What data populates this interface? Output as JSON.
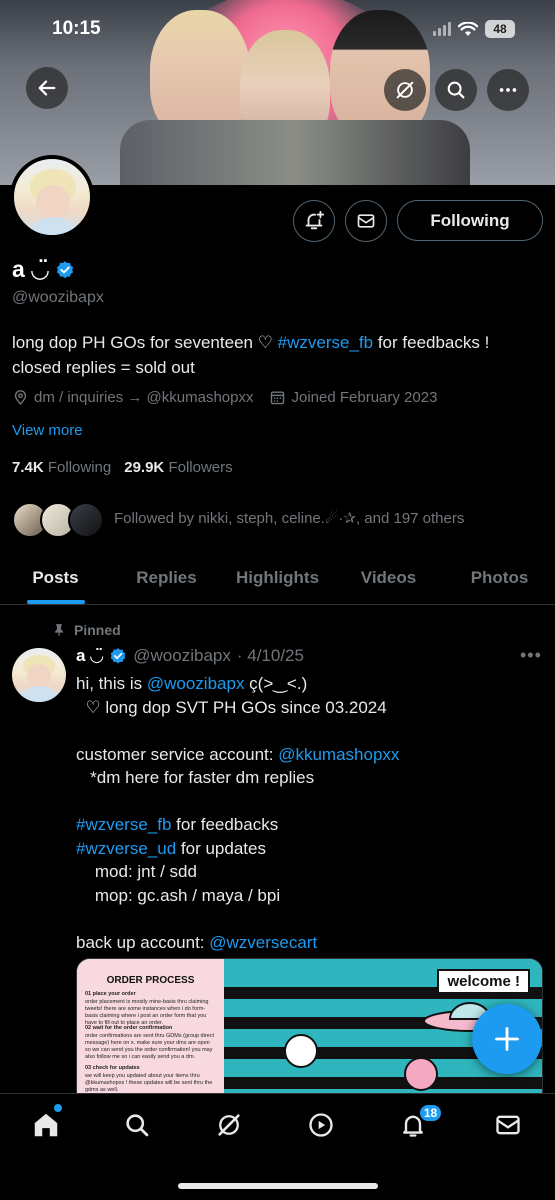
{
  "status_bar": {
    "time": "10:15",
    "battery": "48"
  },
  "profile": {
    "name": "a ◡̈",
    "handle": "@woozibapx",
    "bio_text": "long dop PH GOs for seventeen ♡ ",
    "bio_tag": "#wzverse_fb",
    "bio_after": " for feedbacks ! closed replies = sold out",
    "location": "dm / inquiries → @kkumashopxx",
    "joined": "Joined February 2023",
    "view_more": "View more",
    "following_count": "7.4K",
    "following_label": "Following",
    "followers_count": "29.9K",
    "followers_label": "Followers",
    "followed_by": "Followed by nikki, steph, celine.☄·✰, and 197 others",
    "following_button": "Following"
  },
  "tabs": [
    {
      "label": "Posts",
      "active": true
    },
    {
      "label": "Replies",
      "active": false
    },
    {
      "label": "Highlights",
      "active": false
    },
    {
      "label": "Videos",
      "active": false
    },
    {
      "label": "Photos",
      "active": false
    }
  ],
  "pinned_post": {
    "pinned_label": "Pinned",
    "name": "a ◡̈",
    "handle": "@woozibapx",
    "date": "· 4/10/25",
    "lines": {
      "l1_pre": "hi, this is ",
      "l1_link": "@woozibapx",
      "l1_post": " ç(>‿<.)",
      "l2": "  ♡ long dop SVT PH GOs since 03.2024",
      "l3_pre": "customer service account: ",
      "l3_link": "@kkumashopxx",
      "l4": "   *dm here for faster dm replies",
      "l5_link": "#wzverse_fb",
      "l5_post": " for feedbacks",
      "l6_link": "#wzverse_ud",
      "l6_post": " for updates",
      "l7": "    mod: jnt / sdd",
      "l8": "    mop: gc.ash / maya / bpi",
      "l9_pre": "back up account: ",
      "l9_link": "@wzversecart"
    },
    "media": {
      "order_title": "ORDER PROCESS",
      "welcome": "welcome !",
      "steps": [
        "01  place your order",
        "order placement is mostly mine-basis thru claiming tweets! there are some instances when i do form-basis claiming where i post an order form that you have to fill out to place an order.",
        "02  wait for the order confirmation",
        "order confirmations are sent thru GDMs (group direct message) here on x. make sure your dms are open so we can send you the order confirmation! you may also follow me so i can easily send you a dm.",
        "03  check for updates",
        "we will keep you updated about your items thru @kkumashopxx ! these updates will be sent thru the gdms as well."
      ]
    }
  },
  "bottom_nav": {
    "notifications_badge": "18"
  },
  "colors": {
    "accent": "#1d9bf0",
    "background": "#000000",
    "secondary_text": "#71767b"
  },
  "icons": [
    "back-arrow-icon",
    "grok-icon",
    "search-icon",
    "more-icon",
    "bell-plus-icon",
    "mail-icon",
    "verified-icon",
    "location-icon",
    "calendar-icon",
    "pin-icon",
    "home-icon",
    "compose-plus-icon",
    "play-icon",
    "bell-icon"
  ]
}
